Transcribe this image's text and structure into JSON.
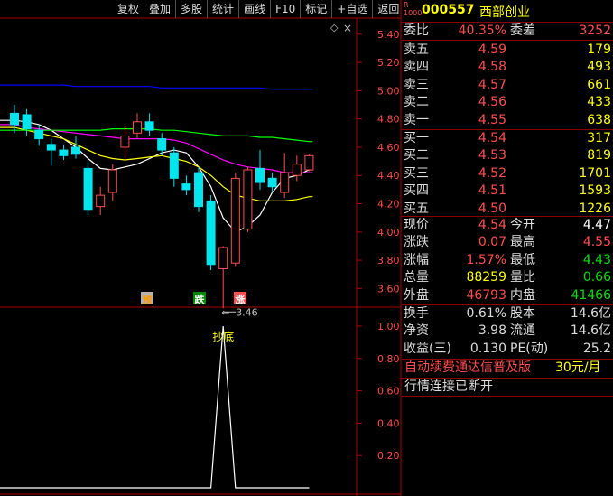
{
  "toolbar": {
    "buttons": [
      "复权",
      "叠加",
      "多股",
      "统计",
      "画线",
      "F10",
      "标记",
      "+自选",
      "返回"
    ]
  },
  "stock": {
    "badge_top": "R",
    "badge_bottom": "1000",
    "code": "000557",
    "name": "西部创业"
  },
  "weibi": {
    "label1": "委比",
    "value1": "40.35%",
    "label2": "委差",
    "value2": "3252"
  },
  "asks": [
    {
      "label": "卖五",
      "price": "4.59",
      "vol": "179"
    },
    {
      "label": "卖四",
      "price": "4.58",
      "vol": "493"
    },
    {
      "label": "卖三",
      "price": "4.57",
      "vol": "661"
    },
    {
      "label": "卖二",
      "price": "4.56",
      "vol": "433"
    },
    {
      "label": "卖一",
      "price": "4.55",
      "vol": "638"
    }
  ],
  "bids": [
    {
      "label": "买一",
      "price": "4.54",
      "vol": "317"
    },
    {
      "label": "买二",
      "price": "4.53",
      "vol": "819"
    },
    {
      "label": "买三",
      "price": "4.52",
      "vol": "1701"
    },
    {
      "label": "买四",
      "price": "4.51",
      "vol": "1593"
    },
    {
      "label": "买五",
      "price": "4.50",
      "vol": "1226"
    }
  ],
  "quote": [
    {
      "l1": "现价",
      "v1": "4.54",
      "l2": "今开",
      "v2": "4.47"
    },
    {
      "l1": "涨跌",
      "v1": "0.07",
      "l2": "最高",
      "v2": "4.55"
    },
    {
      "l1": "涨幅",
      "v1": "1.57%",
      "l2": "最低",
      "v2": "4.43"
    },
    {
      "l1": "总量",
      "v1": "88259",
      "l2": "量比",
      "v2": "0.66"
    },
    {
      "l1": "外盘",
      "v1": "46793",
      "l2": "内盘",
      "v2": "41466"
    }
  ],
  "stats": [
    {
      "l1": "换手",
      "v1": "0.61%",
      "l2": "股本",
      "v2": "14.6亿"
    },
    {
      "l1": "净资",
      "v1": "3.98",
      "l2": "流通",
      "v2": "14.6亿"
    },
    {
      "l1": "收益(三)",
      "v1": "0.130",
      "l2": "PE(动)",
      "v2": "25.2"
    }
  ],
  "promo": {
    "text": "自动续费通达信普及版",
    "price": "30元/月"
  },
  "status": {
    "text": "行情连接已断开"
  },
  "colors": {
    "up": "#ff4d4d",
    "down": "#00e5ee",
    "ma5": "#ffffff",
    "ma10": "#ffff00",
    "ma20": "#ff00ff",
    "ma60": "#00ff00",
    "ma120": "#0000ff",
    "border": "#b00000"
  },
  "chart_data": [
    {
      "type": "candlestick",
      "y_ticks": [
        "5.40",
        "5.20",
        "5.00",
        "4.80",
        "4.60",
        "4.40",
        "4.20",
        "4.00",
        "3.80",
        "3.60"
      ],
      "ylim": [
        3.5,
        5.45
      ],
      "low_annotation": "3.46",
      "markers": [
        "预",
        "跌",
        "涨"
      ],
      "candles": [
        {
          "o": 4.84,
          "c": 4.76,
          "h": 4.9,
          "l": 4.7
        },
        {
          "o": 4.83,
          "c": 4.73,
          "h": 4.87,
          "l": 4.68
        },
        {
          "o": 4.72,
          "c": 4.66,
          "h": 4.76,
          "l": 4.61
        },
        {
          "o": 4.62,
          "c": 4.58,
          "h": 4.66,
          "l": 4.47
        },
        {
          "o": 4.58,
          "c": 4.54,
          "h": 4.62,
          "l": 4.51
        },
        {
          "o": 4.6,
          "c": 4.55,
          "h": 4.68,
          "l": 4.52
        },
        {
          "o": 4.45,
          "c": 4.16,
          "h": 4.5,
          "l": 4.12
        },
        {
          "o": 4.18,
          "c": 4.26,
          "h": 4.32,
          "l": 4.12
        },
        {
          "o": 4.28,
          "c": 4.44,
          "h": 4.48,
          "l": 4.22
        },
        {
          "o": 4.6,
          "c": 4.68,
          "h": 4.74,
          "l": 4.52
        },
        {
          "o": 4.7,
          "c": 4.78,
          "h": 4.84,
          "l": 4.66
        },
        {
          "o": 4.78,
          "c": 4.72,
          "h": 4.84,
          "l": 4.68
        },
        {
          "o": 4.66,
          "c": 4.58,
          "h": 4.7,
          "l": 4.54
        },
        {
          "o": 4.56,
          "c": 4.38,
          "h": 4.6,
          "l": 4.32
        },
        {
          "o": 4.34,
          "c": 4.3,
          "h": 4.4,
          "l": 4.26
        },
        {
          "o": 4.42,
          "c": 4.18,
          "h": 4.46,
          "l": 4.14
        },
        {
          "o": 4.22,
          "c": 3.77,
          "h": 4.26,
          "l": 3.73
        },
        {
          "o": 3.74,
          "c": 3.89,
          "h": 3.9,
          "l": 3.46
        },
        {
          "o": 3.78,
          "c": 4.38,
          "h": 4.42,
          "l": 3.76
        },
        {
          "o": 4.02,
          "c": 4.44,
          "h": 4.46,
          "l": 4.0
        },
        {
          "o": 4.45,
          "c": 4.35,
          "h": 4.58,
          "l": 4.3
        },
        {
          "o": 4.38,
          "c": 4.32,
          "h": 4.42,
          "l": 4.28
        },
        {
          "o": 4.28,
          "c": 4.42,
          "h": 4.56,
          "l": 4.24
        },
        {
          "o": 4.4,
          "c": 4.48,
          "h": 4.54,
          "l": 4.36
        },
        {
          "o": 4.44,
          "c": 4.54,
          "h": 4.55,
          "l": 4.43
        }
      ],
      "ma": [
        {
          "name": "ma5",
          "values": [
            4.79,
            4.78,
            4.76,
            4.72,
            4.66,
            4.6,
            4.52,
            4.45,
            4.44,
            4.46,
            4.48,
            4.52,
            4.56,
            4.58,
            4.56,
            4.46,
            4.32,
            4.1,
            4.0,
            4.04,
            4.12,
            4.28,
            4.38,
            4.4,
            4.44
          ]
        },
        {
          "name": "ma10",
          "values": [
            4.74,
            4.72,
            4.7,
            4.68,
            4.66,
            4.62,
            4.58,
            4.54,
            4.52,
            4.51,
            4.52,
            4.53,
            4.54,
            4.52,
            4.5,
            4.46,
            4.4,
            4.32,
            4.26,
            4.24,
            4.22,
            4.22,
            4.22,
            4.23,
            4.25
          ]
        },
        {
          "name": "ma20",
          "values": [
            4.76,
            4.74,
            4.73,
            4.72,
            4.71,
            4.7,
            4.69,
            4.68,
            4.67,
            4.66,
            4.66,
            4.66,
            4.66,
            4.65,
            4.63,
            4.59,
            4.55,
            4.51,
            4.48,
            4.46,
            4.45,
            4.44,
            4.42,
            4.42,
            4.42
          ]
        },
        {
          "name": "ma60",
          "values": [
            4.72,
            4.72,
            4.72,
            4.72,
            4.72,
            4.72,
            4.72,
            4.72,
            4.73,
            4.73,
            4.73,
            4.73,
            4.72,
            4.72,
            4.71,
            4.7,
            4.69,
            4.68,
            4.68,
            4.68,
            4.67,
            4.67,
            4.66,
            4.65,
            4.64
          ]
        },
        {
          "name": "ma120",
          "values": [
            5.04,
            5.04,
            5.04,
            5.04,
            5.04,
            5.03,
            5.03,
            5.03,
            5.03,
            5.03,
            5.03,
            5.03,
            5.02,
            5.02,
            5.02,
            5.02,
            5.02,
            5.02,
            5.02,
            5.02,
            5.02,
            5.01,
            5.01,
            5.01,
            5.01
          ]
        }
      ]
    },
    {
      "type": "line",
      "y_ticks": [
        "1.00",
        "0.80",
        "0.60",
        "0.40",
        "0.20"
      ],
      "ylim": [
        0,
        1.05
      ],
      "annotation": "抄底",
      "x": [
        0,
        1,
        2,
        3,
        4,
        5,
        6,
        7,
        8,
        9,
        10,
        11,
        12,
        13,
        14,
        15,
        16,
        17,
        18,
        19,
        20,
        21,
        22,
        23,
        24
      ],
      "values": [
        0,
        0,
        0,
        0,
        0,
        0,
        0,
        0,
        0,
        0,
        0,
        0,
        0,
        0,
        0,
        0,
        0,
        1,
        0,
        0,
        0,
        0,
        0,
        0,
        0
      ]
    }
  ]
}
